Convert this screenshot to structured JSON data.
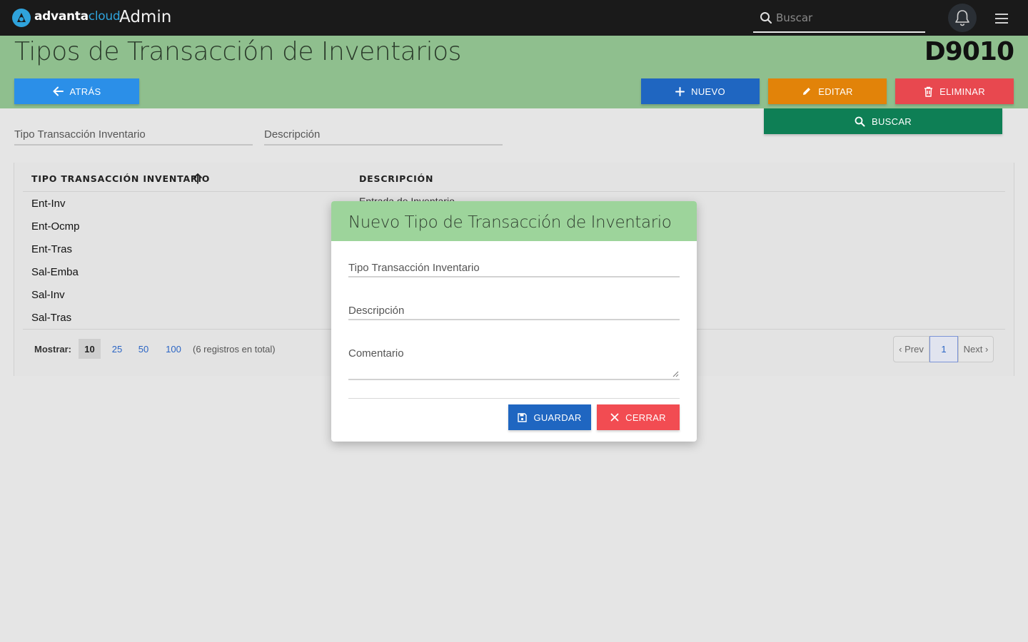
{
  "topbar": {
    "brand_part1": "advanta",
    "brand_part2": "cloud",
    "app_name": "Admin",
    "search_placeholder": "Buscar"
  },
  "header": {
    "title": "Tipos de Transacción de Inventarios",
    "code": "D9010"
  },
  "actions": {
    "back": "ATRÁS",
    "new": "NUEVO",
    "edit": "EDITAR",
    "delete": "ELIMINAR",
    "search": "BUSCAR"
  },
  "filters": {
    "tipo": "Tipo Transacción Inventario",
    "descripcion": "Descripción"
  },
  "table": {
    "columns": [
      "TIPO TRANSACCIÓN INVENTARIO",
      "DESCRIPCIÓN"
    ],
    "rows": [
      "Ent-Inv",
      "Ent-Ocmp",
      "Ent-Tras",
      "Sal-Emba",
      "Sal-Inv",
      "Sal-Tras"
    ],
    "first_description_partial": "Entrada de Inventario"
  },
  "footer": {
    "show_label": "Mostrar:",
    "page_sizes": [
      "10",
      "25",
      "50",
      "100"
    ],
    "active_page_size": "10",
    "total": "(6 registros en total)"
  },
  "pager": {
    "prev": "‹ Prev",
    "current": "1",
    "next": "Next ›"
  },
  "modal": {
    "title": "Nuevo Tipo de Transacción de Inventario",
    "field_tipo": "Tipo Transacción Inventario",
    "field_descripcion": "Descripción",
    "field_comentario": "Comentario",
    "save": "GUARDAR",
    "close": "CERRAR"
  },
  "colors": {
    "header_band": "#8fbf8e",
    "modal_header": "#9dd49b",
    "primary": "#1f66c1",
    "back": "#2b8fe8",
    "warning": "#e28309",
    "danger": "#e8484f",
    "success": "#0e7f55"
  },
  "icons": {
    "logo": "advantacloud-logo-icon",
    "search": "search-icon",
    "bell": "bell-icon",
    "menu": "hamburger-menu-icon",
    "back": "arrow-left-icon",
    "new": "plus-icon",
    "edit": "pencil-icon",
    "delete": "trash-icon",
    "sort": "arrow-up-icon",
    "save": "floppy-disk-icon",
    "close": "close-icon"
  }
}
